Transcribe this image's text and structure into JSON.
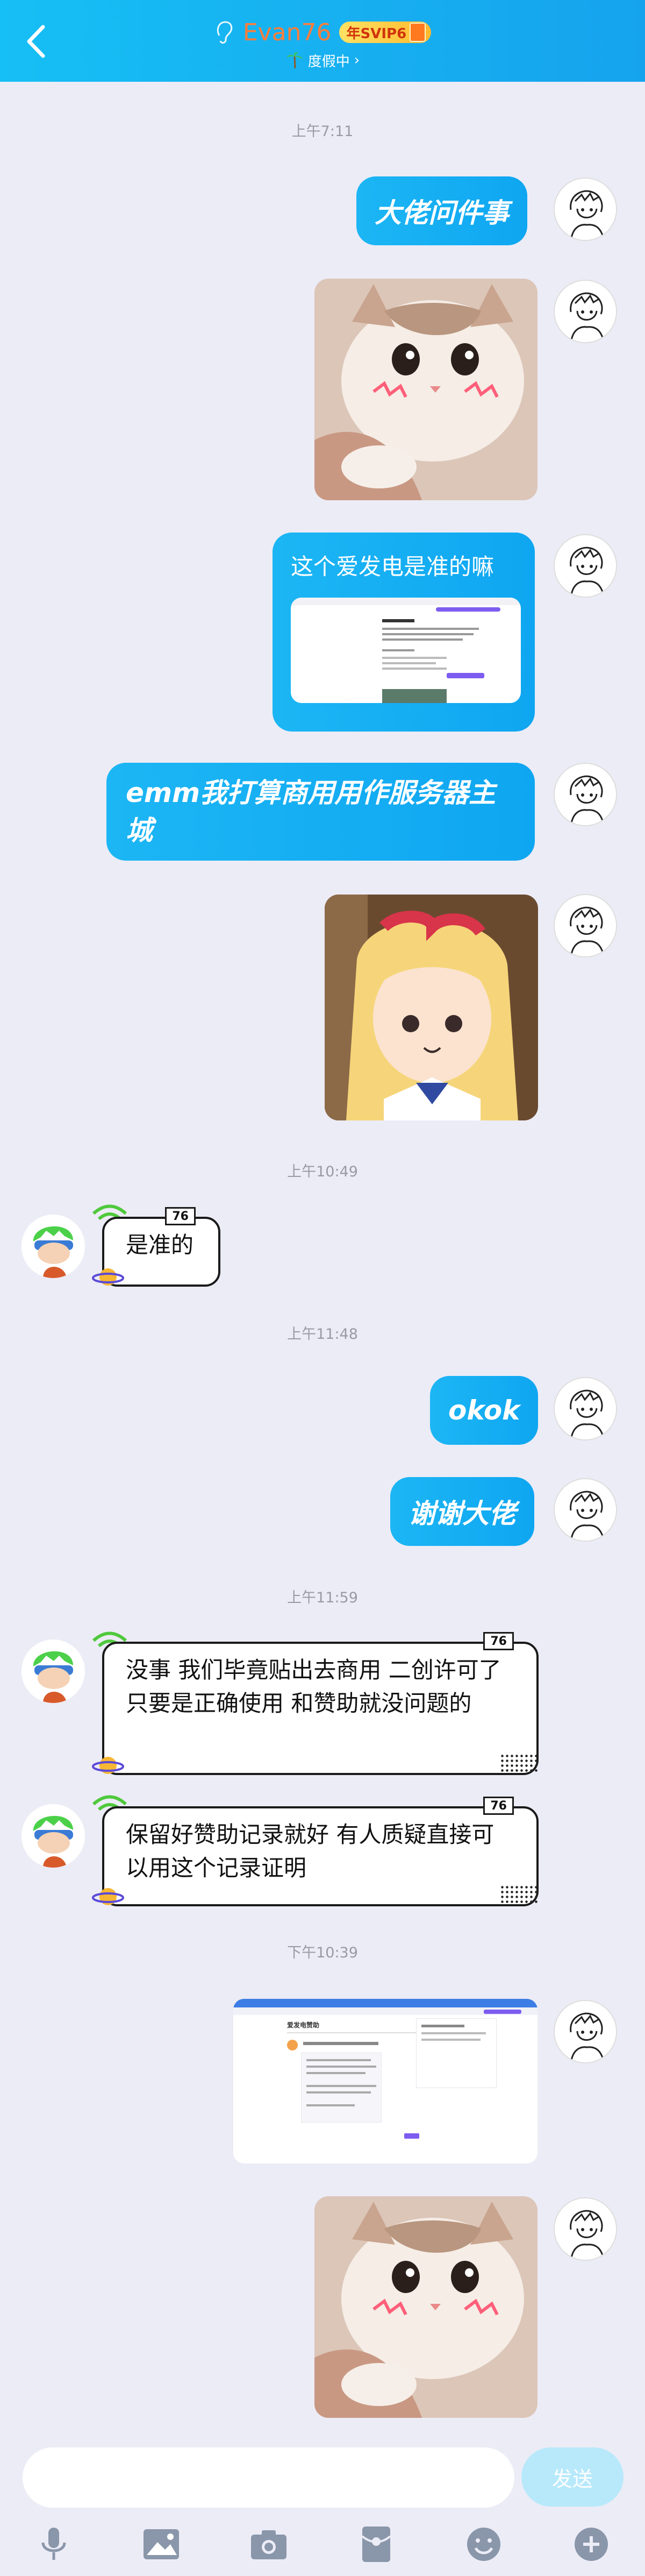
{
  "header": {
    "title": "Evan76",
    "vip_label": "年SVIP6",
    "status": "度假中",
    "colors": {
      "accent": "#16bff5",
      "name": "#ff7d3a"
    }
  },
  "timestamps": [
    "上午7:11",
    "上午10:49",
    "上午11:48",
    "上午11:59",
    "下午10:39"
  ],
  "messages": {
    "m1": "大佬问件事",
    "m3": "这个爱发电是准的嘛",
    "m4": "emm我打算商用用作服务器主城",
    "m6": "是准的",
    "m7": "okok",
    "m8": "谢谢大佬",
    "m9": "没事  我们毕竟贴出去商用 二创许可了  只要是正确使用 和赞助就没问题的",
    "m10": "保留好赞助记录就好 有人质疑直接可以用这个记录证明"
  },
  "badge_level": "76",
  "screenshot_preview": {
    "title": "爱发电赞助"
  },
  "input": {
    "placeholder": "",
    "send_label": "发送"
  },
  "toolbar": {
    "icons": [
      "microphone-icon",
      "image-icon",
      "camera-icon",
      "red-packet-icon",
      "emoji-icon",
      "plus-icon"
    ]
  }
}
